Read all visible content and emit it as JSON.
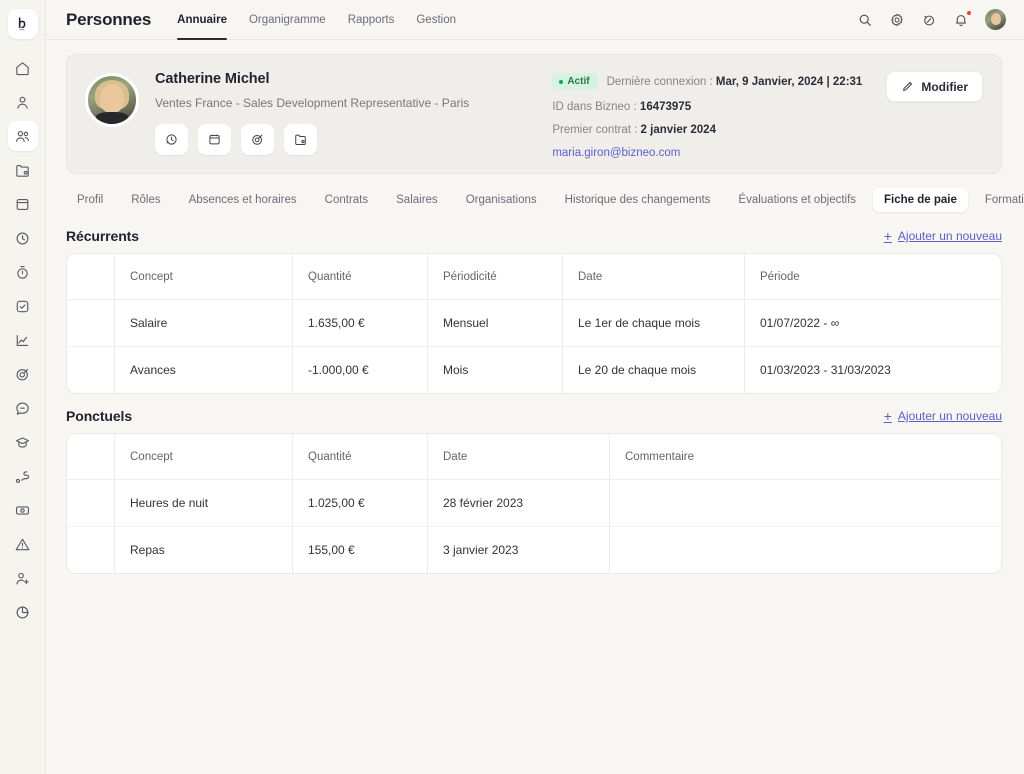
{
  "brand": {
    "logo_glyph": "b",
    "accent": "#5b5fc7"
  },
  "sidebar": {
    "items": [
      {
        "icon": "home-icon",
        "name": "home"
      },
      {
        "icon": "person-icon",
        "name": "person"
      },
      {
        "icon": "people-icon",
        "name": "people",
        "active": true
      },
      {
        "icon": "folder-icon",
        "name": "folder"
      },
      {
        "icon": "archive-icon",
        "name": "archive"
      },
      {
        "icon": "clock-icon",
        "name": "clock"
      },
      {
        "icon": "timer-icon",
        "name": "timer"
      },
      {
        "icon": "task-check-icon",
        "name": "tasks"
      },
      {
        "icon": "chart-line-icon",
        "name": "analytics"
      },
      {
        "icon": "target-icon",
        "name": "objectives"
      },
      {
        "icon": "chat-icon",
        "name": "messages"
      },
      {
        "icon": "graduation-cap-icon",
        "name": "training"
      },
      {
        "icon": "journey-icon",
        "name": "journey"
      },
      {
        "icon": "money-icon",
        "name": "payroll"
      },
      {
        "icon": "alert-triangle-icon",
        "name": "alerts"
      },
      {
        "icon": "person-add-icon",
        "name": "recruiting"
      },
      {
        "icon": "pie-chart-icon",
        "name": "reports"
      }
    ]
  },
  "header": {
    "title": "Personnes",
    "nav": [
      {
        "label": "Annuaire",
        "active": true
      },
      {
        "label": "Organigramme",
        "active": false
      },
      {
        "label": "Rapports",
        "active": false
      },
      {
        "label": "Gestion",
        "active": false
      }
    ],
    "icons": [
      {
        "name": "search-icon"
      },
      {
        "name": "gear-icon"
      },
      {
        "name": "help-compass-icon"
      },
      {
        "name": "bell-icon",
        "badge": true
      },
      {
        "name": "user-avatar"
      }
    ]
  },
  "profile": {
    "avatar": "employee-photo",
    "name": "Catherine Michel",
    "role": "Ventes France - Sales Development Representative - Paris",
    "actions": [
      {
        "name": "time-tracking-icon"
      },
      {
        "name": "calendar-icon"
      },
      {
        "name": "objectives-target-icon"
      },
      {
        "name": "documents-folder-icon"
      }
    ],
    "status_badge": "Actif",
    "last_connection_label": "Dernière connexion :",
    "last_connection_value": "Mar, 9 Janvier, 2024 | 22:31",
    "id_label": "ID dans Bizneo :",
    "id_value": "16473975",
    "first_contract_label": "Premier contrat :",
    "first_contract_value": "2 janvier 2024",
    "email": "maria.giron@bizneo.com",
    "edit_button": "Modifier"
  },
  "tabs": [
    {
      "label": "Profil",
      "active": false
    },
    {
      "label": "Rôles",
      "active": false
    },
    {
      "label": "Absences et horaires",
      "active": false
    },
    {
      "label": "Contrats",
      "active": false
    },
    {
      "label": "Salaires",
      "active": false
    },
    {
      "label": "Organisations",
      "active": false
    },
    {
      "label": "Historique des changements",
      "active": false
    },
    {
      "label": "Évaluations et objectifs",
      "active": false
    },
    {
      "label": "Fiche de paie",
      "active": true
    },
    {
      "label": "Formation",
      "active": false
    }
  ],
  "sections": [
    {
      "title": "Récurrents",
      "add_label": "Ajouter un nouveau",
      "columns": [
        "Concept",
        "Quantité",
        "Périodicité",
        "Date",
        "Période"
      ],
      "rows": [
        {
          "concept": "Salaire",
          "quantite": "1.635,00 €",
          "periodicite": "Mensuel",
          "date": "Le 1er de chaque mois",
          "periode": "01/07/2022 - ∞"
        },
        {
          "concept": "Avances",
          "quantite": "-1.000,00 €",
          "periodicite": "Mois",
          "date": "Le 20 de chaque mois",
          "periode": "01/03/2023 - 31/03/2023"
        }
      ]
    },
    {
      "title": "Ponctuels",
      "add_label": "Ajouter un nouveau",
      "columns": [
        "Concept",
        "Quantité",
        "Date",
        "Commentaire"
      ],
      "rows": [
        {
          "concept": "Heures de nuit",
          "quantite": "1.025,00 €",
          "date": "28 février 2023",
          "commentaire": ""
        },
        {
          "concept": "Repas",
          "quantite": "155,00 €",
          "date": "3 janvier 2023",
          "commentaire": ""
        }
      ]
    }
  ]
}
